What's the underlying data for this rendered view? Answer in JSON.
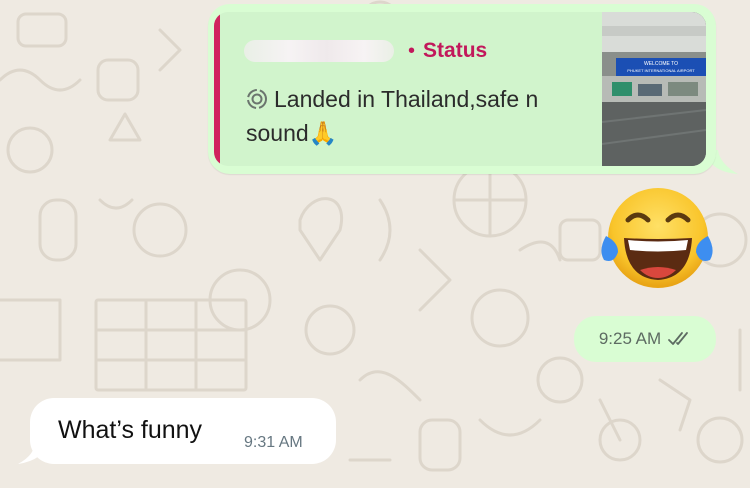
{
  "reply_quote": {
    "sender_name_redacted": true,
    "dot": "•",
    "label": "Status",
    "text": "Landed in Thailand,safe n sound🙏",
    "thumbnail_sign": "WELCOME TO PHUKET INTERNATIONAL AIRPORT",
    "accent_color": "#d0245e"
  },
  "sent_emoji": "face-with-tears-of-joy",
  "outgoing": {
    "time": "9:25 AM",
    "status": "read"
  },
  "incoming": {
    "text": "What’s funny",
    "time": "9:31 AM"
  },
  "colors": {
    "outgoing_bg": "#d9fdd3",
    "incoming_bg": "#ffffff",
    "wallpaper": "#efeae2"
  }
}
